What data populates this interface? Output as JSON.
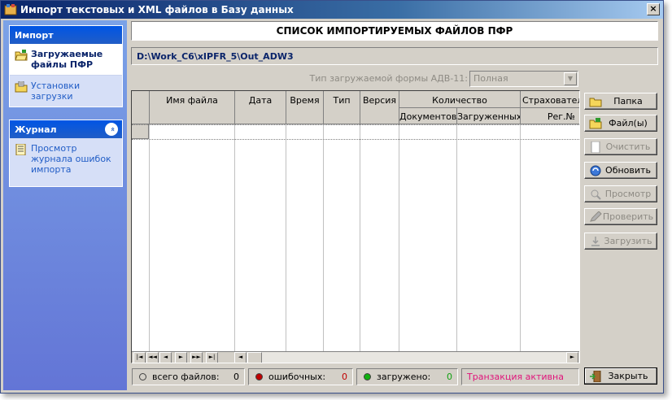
{
  "window": {
    "title": "Импорт текстовых и XML файлов в Базу данных",
    "close_label": "×"
  },
  "sidebar": {
    "import_group": {
      "title": "Импорт",
      "items": [
        {
          "label": "Загружаемые файлы ПФР",
          "active": true,
          "icon": "folder-open-icon"
        },
        {
          "label": "Установки загрузки",
          "active": false,
          "icon": "settings-folder-icon"
        }
      ]
    },
    "journal_group": {
      "title": "Журнал",
      "collapse_glyph": "«",
      "items": [
        {
          "label": "Просмотр журнала ошибок импорта",
          "icon": "log-icon"
        }
      ]
    }
  },
  "main": {
    "header": "СПИСОК ИМПОРТИРУЕМЫХ ФАЙЛОВ ПФР",
    "path": "D:\\Work_C6\\xIPFR_5\\Out_ADW3",
    "form_type": {
      "label": "Тип загружаемой формы АДВ-11:",
      "value": "Полная"
    },
    "grid": {
      "columns": [
        "Имя файла",
        "Дата",
        "Время",
        "Тип",
        "Версия"
      ],
      "group_count": "Количество",
      "count_cols": [
        "Документов",
        "Загруженных"
      ],
      "group_insurer": "Страхователь",
      "insurer_cols": [
        "Рег.№"
      ]
    },
    "nav": [
      "|◄",
      "◄◄",
      "◄",
      "►",
      "►►",
      "►|"
    ]
  },
  "buttons": {
    "folder": "Папка",
    "files": "Файл(ы)",
    "clear": "Очистить",
    "refresh": "Обновить",
    "view": "Просмотр",
    "check": "Проверить",
    "load": "Загрузить",
    "close": "Закрыть"
  },
  "status": {
    "total_label": "всего файлов:",
    "total_value": "0",
    "errors_label": "ошибочных:",
    "errors_value": "0",
    "loaded_label": "загружено:",
    "loaded_value": "0",
    "transaction": "Транзакция активна"
  },
  "colors": {
    "error_dot": "#c00000",
    "loaded_dot": "#10b010",
    "transaction_text": "#e0147a"
  }
}
